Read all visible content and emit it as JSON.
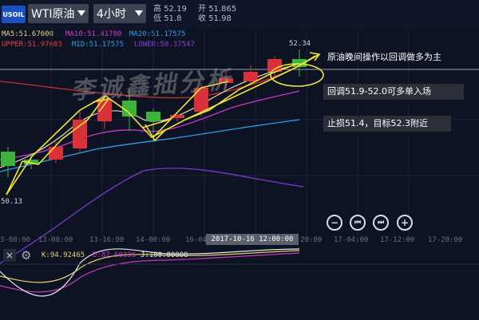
{
  "header": {
    "symbol_badge": "USOIL",
    "instrument": "WTI原油",
    "timeframe": "4小时",
    "high_label": "高",
    "high_value": "52.19",
    "low_label": "低",
    "low_value": "51.8",
    "open_label": "开",
    "open_value": "51.865",
    "close_label": "收",
    "close_value": "51.98"
  },
  "indicators": {
    "ma5": "MA5:51.67600",
    "ma10": "MA10:51.41700",
    "ma20": "MA20:51.17575",
    "upper": "UPPER:51.97603",
    "mid": "MID:51.17575",
    "lower": "LOWER:50.37547"
  },
  "annotations": {
    "a1": "原油晚间操作以回调做多为主",
    "a2": "回调51.9-52.0可多单入场",
    "a3": "止损51.4，目标52.3附近"
  },
  "price_marks": {
    "high": "52.34",
    "low": "50.13"
  },
  "watermark": "李诚鑫拙分析",
  "navigation": {
    "zoom_out": "−",
    "prev": "⏮",
    "next": "⏭",
    "zoom_in": "+"
  },
  "xaxis": {
    "labels": [
      "3-08:00",
      "13-08:00",
      "13-16:00",
      "14-00:00",
      "16-04",
      "16-20:00",
      "17-04:00",
      "17-12:00",
      "17-20:00"
    ],
    "cursor": "2017-10-16 12:00:00"
  },
  "kdj": {
    "close_label": "×",
    "settings_icon": "⚙",
    "k": "K:94.92465",
    "d": "D:87.60336",
    "j": "J:100.00000"
  },
  "colors": {
    "bg": "#0e1324",
    "bull": "#d8313a",
    "bear": "#3cb43c",
    "ma5": "#e8e0b0",
    "ma10": "#d23bd2",
    "ma20": "#2f9fe8",
    "upper": "#e84040",
    "lower": "#8a3fd8",
    "annotation": "#f2e23c"
  }
}
